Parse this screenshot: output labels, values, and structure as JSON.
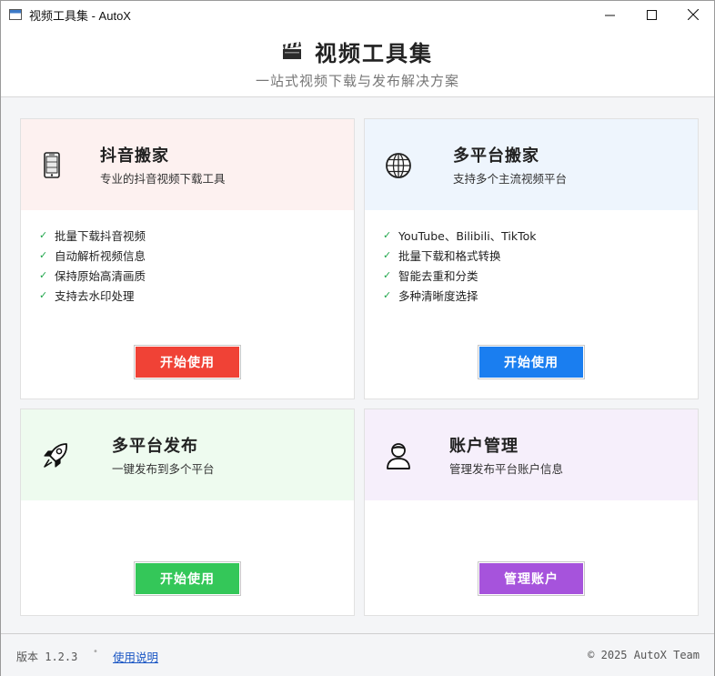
{
  "window": {
    "title": "视频工具集 - AutoX",
    "controls": {
      "minimize": "—",
      "maximize": "☐",
      "close": "✕"
    }
  },
  "header": {
    "icon": "clapperboard-icon",
    "title": "视频工具集",
    "subtitle": "一站式视频下载与发布解决方案"
  },
  "cards": {
    "douyin": {
      "icon": "phone-icon",
      "title": "抖音搬家",
      "desc": "专业的抖音视频下载工具",
      "features": [
        "批量下载抖音视频",
        "自动解析视频信息",
        "保持原始高清画质",
        "支持去水印处理"
      ],
      "button": "开始使用",
      "head_color": "#fdf1f0",
      "button_color": "#f04236"
    },
    "multi_move": {
      "icon": "globe-icon",
      "title": "多平台搬家",
      "desc": "支持多个主流视频平台",
      "features": [
        "YouTube、Bilibili、TikTok",
        "批量下载和格式转换",
        "智能去重和分类",
        "多种清晰度选择"
      ],
      "button": "开始使用",
      "head_color": "#eef5fd",
      "button_color": "#1a7ef0"
    },
    "publish": {
      "icon": "rocket-icon",
      "title": "多平台发布",
      "desc": "一键发布到多个平台",
      "button": "开始使用",
      "head_color": "#eefbef",
      "button_color": "#34c759"
    },
    "account": {
      "icon": "user-icon",
      "title": "账户管理",
      "desc": "管理发布平台账户信息",
      "button": "管理账户",
      "head_color": "#f6effb",
      "button_color": "#a653dc"
    }
  },
  "footer": {
    "version": "版本 1.2.3",
    "separator": "•",
    "help": "使用说明",
    "copyright": "© 2025 AutoX Team"
  }
}
